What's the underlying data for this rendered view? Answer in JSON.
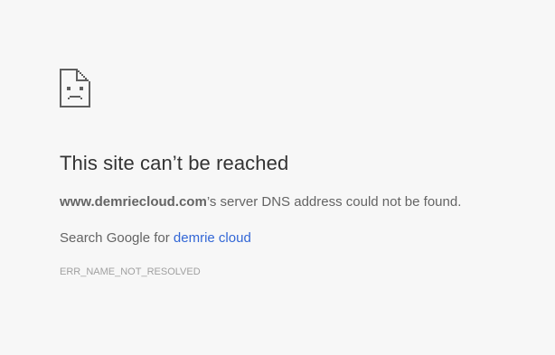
{
  "error_page": {
    "icon": "sad-page-icon",
    "title": "This site can’t be reached",
    "host": "www.demriecloud.com",
    "message_suffix": "’s server DNS address could not be found.",
    "search_prefix": "Search Google for ",
    "search_query": "demrie cloud",
    "error_code": "ERR_NAME_NOT_RESOLVED"
  },
  "colors": {
    "background": "#f7f7f7",
    "title": "#333333",
    "text": "#646464",
    "link": "#3367d6",
    "error_code": "#a0a0a0"
  }
}
